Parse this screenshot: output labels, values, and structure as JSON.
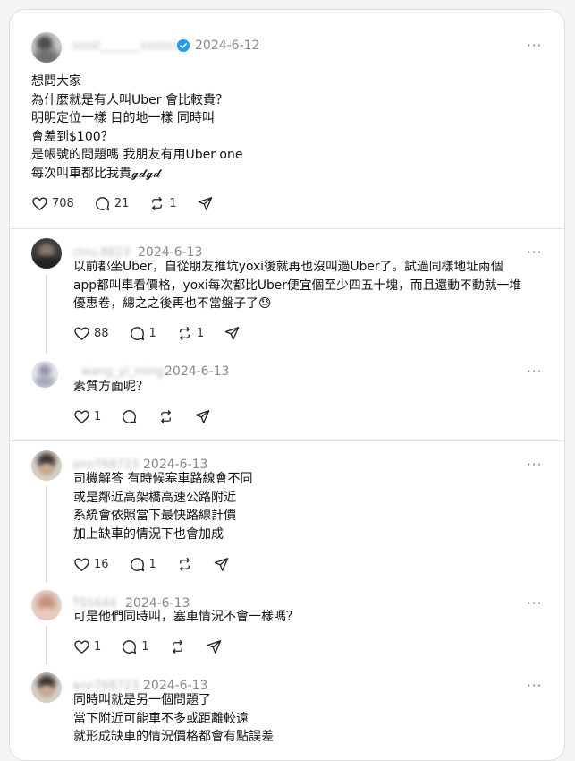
{
  "main_post": {
    "date": "2024-6-12",
    "text": "想問大家\n為什麼就是有人叫Uber 會比較貴？\n明明定位一樣 目的地一樣 同時叫\n會差到$100？\n是帳號的問題嗎 我朋友有用Uber one\n每次叫車都比我貴𝓰𝓭𝓰𝓭",
    "likes": "708",
    "replies": "21",
    "reposts": "1"
  },
  "replies": [
    {
      "date": "2024-6-13",
      "text": "以前都坐Uber，自從朋友推坑yoxi後就再也沒叫過Uber了。試過同樣地址兩個\napp都叫車看價格，yoxi每次都比Uber便宜個至少四五十塊，而且還動不動就一堆\n優惠卷，總之之後再也不當盤子了😓",
      "likes": "88",
      "replies": "1",
      "reposts": "1"
    },
    {
      "date": "2024-6-13",
      "text": "素質方面呢？",
      "likes": "1",
      "replies": "",
      "reposts": ""
    },
    {
      "date": "2024-6-13",
      "text": "司機解答 有時候塞車路線會不同\n或是鄰近高架橋高速公路附近\n系統會依照當下最快路線計價\n加上缺車的情況下也會加成",
      "likes": "16",
      "replies": "1",
      "reposts": ""
    },
    {
      "date": "2024-6-13",
      "text": "可是他們同時叫，塞車情況不會一樣嗎？",
      "likes": "1",
      "replies": "1",
      "reposts": ""
    },
    {
      "date": "2024-6-13",
      "text": "同時叫就是另一個問題了\n當下附近可能車不多或距離較遠\n就形成缺車的情況價格都會有點誤差",
      "likes": "",
      "replies": "",
      "reposts": ""
    }
  ],
  "colors": {
    "verified": "#1d9bf0",
    "date": "#8a8a8a",
    "divider": "#e3e3e3"
  },
  "icons": {
    "like": "heart-icon",
    "reply": "comment-bubble-icon",
    "repost": "repost-arrows-icon",
    "share": "send-paper-plane-icon",
    "more": "more-horizontal-icon"
  }
}
